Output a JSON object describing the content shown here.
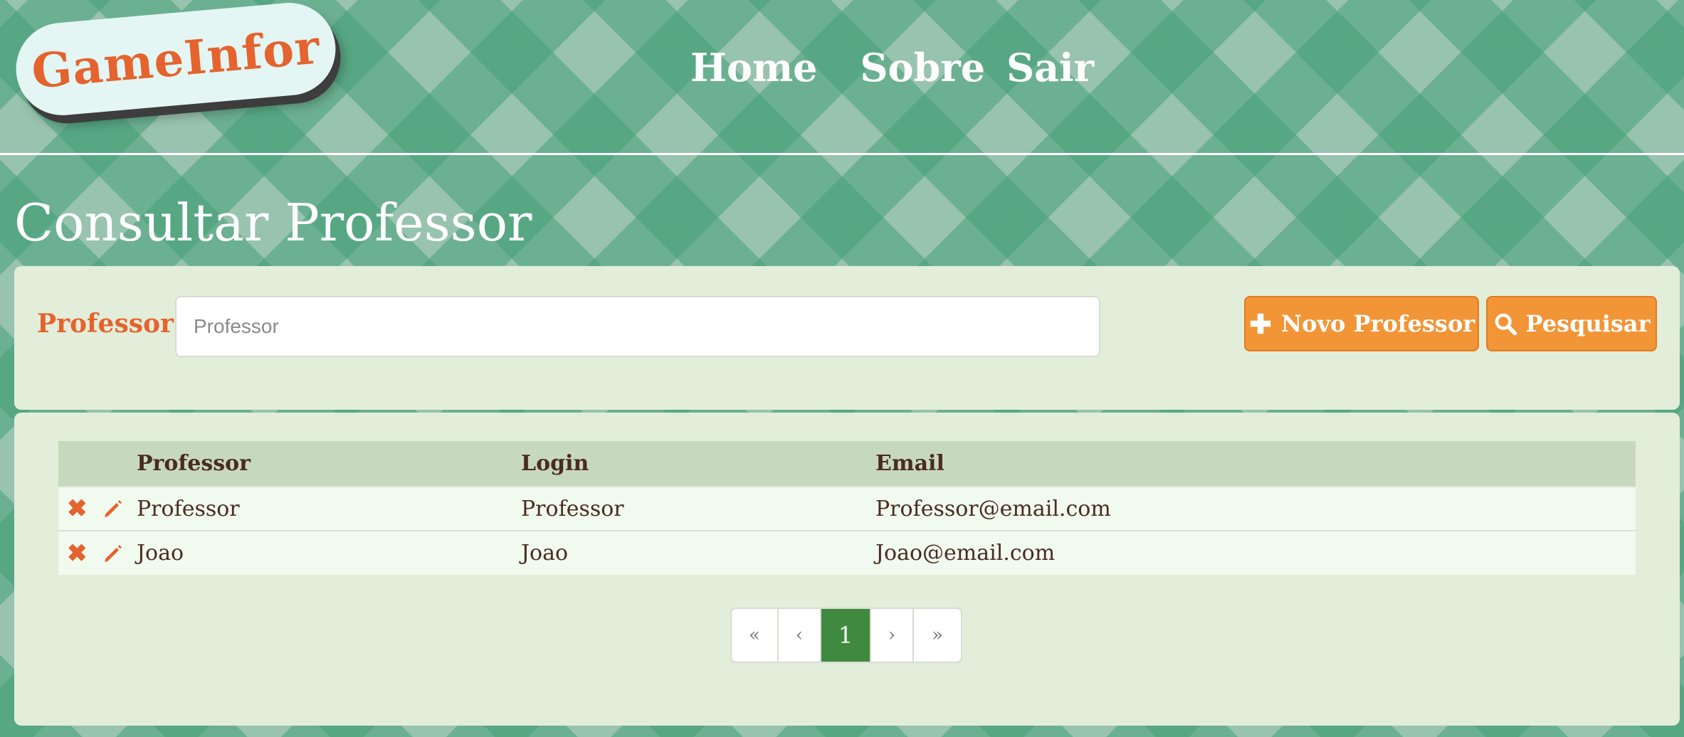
{
  "logo": {
    "text": "GameInfor"
  },
  "nav": {
    "home": "Home",
    "about": "Sobre",
    "logout": "Sair"
  },
  "page": {
    "title": "Consultar Professor"
  },
  "search": {
    "label": "Professor:",
    "placeholder": "Professor",
    "value": "",
    "new_button": "Novo Professor",
    "search_button": "Pesquisar"
  },
  "table": {
    "headers": [
      "",
      "Professor",
      "Login",
      "Email"
    ],
    "rows": [
      {
        "professor": "Professor",
        "login": "Professor",
        "email": "Professor@email.com"
      },
      {
        "professor": "Joao",
        "login": "Joao",
        "email": "Joao@email.com"
      }
    ]
  },
  "pagination": {
    "first": "«",
    "prev": "‹",
    "current": "1",
    "next": "›",
    "last": "»"
  },
  "icons": {
    "delete": "close-icon",
    "edit": "pencil-icon",
    "new": "plus-icon",
    "search": "search-icon"
  },
  "colors": {
    "accent": "#e4632e",
    "button": "#f29537",
    "active_page": "#3f8a3e",
    "panel": "#e2eed9",
    "table_header": "#c7d9bd",
    "row": "#f1faee",
    "background": "#98c3ae"
  }
}
